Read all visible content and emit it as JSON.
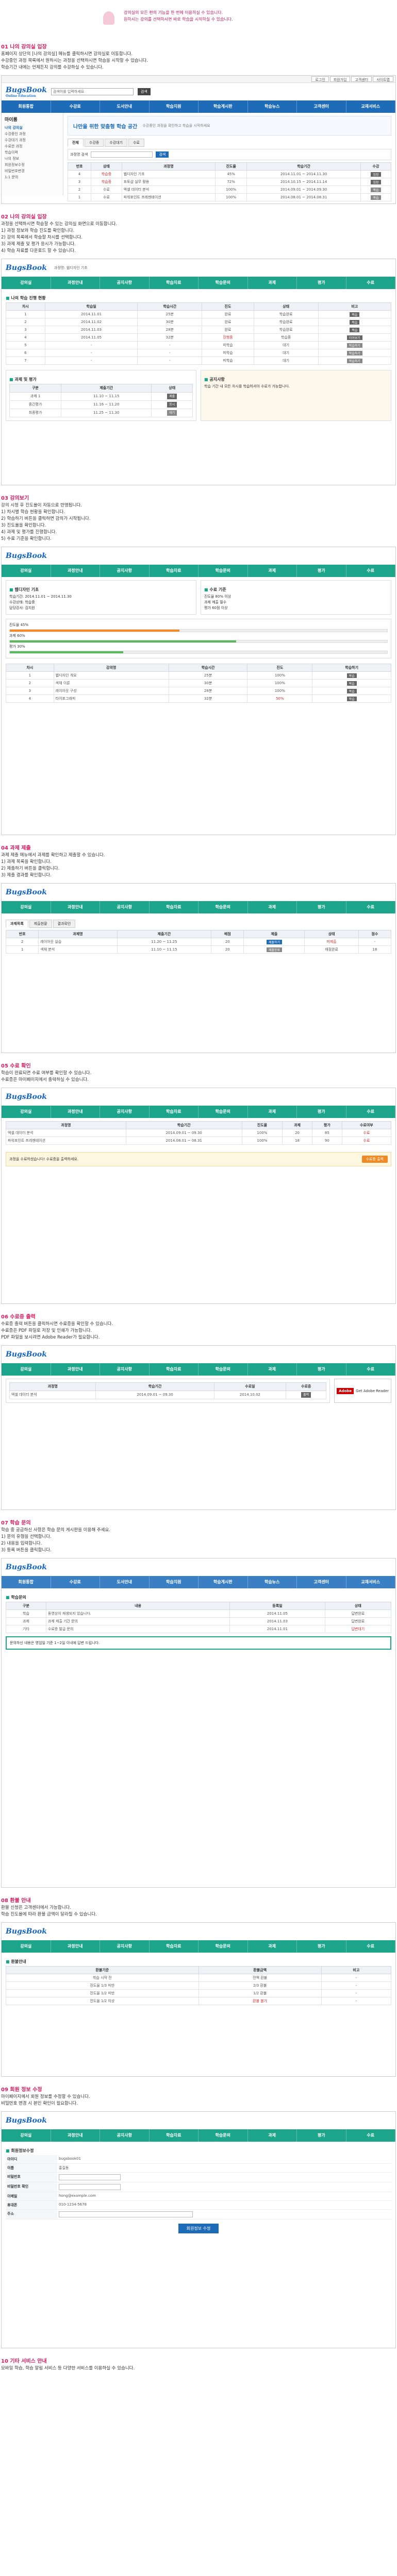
{
  "intro": {
    "lines": [
      "강의실의 모든 편의 기능을 한 번에 이용하실 수 있습니다.",
      "원하시는 강의를 선택하시면 바로 학습을 시작하실 수 있습니다."
    ]
  },
  "sections": [
    {
      "title": "01 나의 강의실 입장",
      "desc": [
        "홈페이지 상단의 [나의 강의실] 메뉴를 클릭하시면 강의실로 이동합니다.",
        "수강중인 과정 목록에서 원하시는 과정을 선택하시면 학습을 시작할 수 있습니다.",
        "학습기간 내에는 언제든지 강의를 수강하실 수 있습니다."
      ]
    },
    {
      "title": "02 나의 강의실 입장",
      "desc": [
        "과정을 선택하시면 학습할 수 있는 강의실 화면으로 이동합니다.",
        "1) 과정 정보와 학습 진도를 확인합니다.",
        "2) 강의 목록에서 학습할 차시를 선택합니다.",
        "3) 과제 제출 및 평가 응시가 가능합니다.",
        "4) 학습 자료를 다운로드 할 수 있습니다."
      ]
    },
    {
      "title": "03 강의보기",
      "desc": [
        "강의 시청 후 진도율이 자동으로 반영됩니다.",
        "1) 차시별 학습 현황을 확인합니다.",
        "2) 학습하기 버튼을 클릭하면 강의가 시작됩니다.",
        "3) 진도율을 확인합니다.",
        "4) 과제 및 평가를 진행합니다.",
        "5) 수료 기준을 확인합니다."
      ]
    },
    {
      "title": "04 과제 제출",
      "desc": [
        "과제 제출 메뉴에서 과제를 확인하고 제출할 수 있습니다.",
        "1) 과제 목록을 확인합니다.",
        "2) 제출하기 버튼을 클릭합니다.",
        "3) 제출 결과를 확인합니다."
      ]
    },
    {
      "title": "05 수료 확인",
      "desc": [
        "학습이 완료되면 수료 여부를 확인할 수 있습니다.",
        "수료증은 마이페이지에서 출력하실 수 있습니다."
      ]
    },
    {
      "title": "06 수료증 출력",
      "desc": [
        "수료증 출력 버튼을 클릭하시면 수료증을 확인할 수 있습니다.",
        "수료증은 PDF 파일로 저장 및 인쇄가 가능합니다.",
        "PDF 파일을 보시려면 Adobe Reader가 필요합니다."
      ]
    },
    {
      "title": "07 학습 문의",
      "desc": [
        "학습 중 궁금하신 사항은 학습 문의 게시판을 이용해 주세요.",
        "1) 문의 유형을 선택합니다.",
        "2) 내용을 입력합니다.",
        "3) 등록 버튼을 클릭합니다."
      ]
    },
    {
      "title": "08 환불 안내",
      "desc": [
        "환불 신청은 고객센터에서 가능합니다.",
        "학습 진도율에 따라 환불 금액이 달라질 수 있습니다."
      ]
    },
    {
      "title": "09 회원 정보 수정",
      "desc": [
        "마이페이지에서 회원 정보를 수정할 수 있습니다.",
        "비밀번호 변경 시 본인 확인이 필요합니다."
      ]
    },
    {
      "title": "10 기타 서비스 안내",
      "desc": [
        "모바일 학습, 학습 알림 서비스 등 다양한 서비스를 이용하실 수 있습니다."
      ]
    }
  ],
  "site": {
    "logo": "BugsBook",
    "logo_sub": "Online Education",
    "search_placeholder": "검색어를 입력하세요",
    "search_btn": "검색",
    "top_links": [
      "로그인",
      "회원가입",
      "고객센터",
      "사이트맵"
    ],
    "nav_blue": [
      "회원통합",
      "수강료",
      "도서안내",
      "학습지원",
      "학습게시판",
      "학습뉴스",
      "고객센터",
      "교재서비스"
    ],
    "nav_teal": [
      "강의실",
      "과정안내",
      "공지사항",
      "학습자료",
      "학습문의",
      "과제",
      "평가",
      "수료"
    ]
  },
  "classroom": {
    "title": "마이룸",
    "side_menu": [
      "나의 강의실",
      "수강중인 과정",
      "수강대기 과정",
      "수료한 과정",
      "학습이력",
      "나의 정보",
      "회원정보수정",
      "비밀번호변경",
      "1:1 문의"
    ],
    "banner_title": "나만을 위한 맞춤형 학습 공간",
    "banner_sub": "수강중인 과정을 확인하고 학습을 시작하세요",
    "tabs": [
      "전체",
      "수강중",
      "수강대기",
      "수료"
    ],
    "filter_label": "과정명 검색",
    "filter_btn": "검색",
    "columns": [
      "번호",
      "상태",
      "과정명",
      "진도율",
      "학습기간",
      "수강"
    ],
    "rows": [
      [
        "4",
        "학습중",
        "웹디자인 기초",
        "45%",
        "2014.11.01 ~ 2014.11.30",
        "입장"
      ],
      [
        "3",
        "학습중",
        "포토샵 실무 활용",
        "72%",
        "2014.10.15 ~ 2014.11.14",
        "입장"
      ],
      [
        "2",
        "수료",
        "엑셀 데이터 분석",
        "100%",
        "2014.09.01 ~ 2014.09.30",
        "복습"
      ],
      [
        "1",
        "수료",
        "파워포인트 프레젠테이션",
        "100%",
        "2014.08.01 ~ 2014.08.31",
        "복습"
      ]
    ]
  },
  "lecture": {
    "breadcrumb": "과정명: 웹디자인 기초",
    "title": "나의 학습 진행 현황",
    "columns": [
      "차시",
      "학습일",
      "학습시간",
      "진도",
      "상태",
      "비고"
    ],
    "rows": [
      [
        "1",
        "2014.11.01",
        "25분",
        "완료",
        "학습완료",
        "복습"
      ],
      [
        "2",
        "2014.11.02",
        "30분",
        "완료",
        "학습완료",
        "복습"
      ],
      [
        "3",
        "2014.11.03",
        "28분",
        "완료",
        "학습완료",
        "복습"
      ],
      [
        "4",
        "2014.11.05",
        "32분",
        "진행중",
        "학습중",
        "이어보기"
      ],
      [
        "5",
        "-",
        "-",
        "미학습",
        "대기",
        "학습하기"
      ],
      [
        "6",
        "-",
        "-",
        "미학습",
        "대기",
        "학습하기"
      ],
      [
        "7",
        "-",
        "-",
        "미학습",
        "대기",
        "학습하기"
      ]
    ],
    "task_title": "과제 및 평가",
    "task_cols": [
      "구분",
      "제출기간",
      "상태"
    ],
    "task_rows": [
      [
        "과제 1",
        "11.10 ~ 11.15",
        "제출"
      ],
      [
        "중간평가",
        "11.16 ~ 11.20",
        "응시"
      ],
      [
        "최종평가",
        "11.25 ~ 11.30",
        "대기"
      ]
    ],
    "notice_title": "공지사항",
    "notice_text": "학습 기간 내 모든 차시를 학습하셔야 수료가 가능합니다."
  },
  "progress": {
    "course": "웹디자인 기초",
    "info": [
      "학습기간: 2014.11.01 ~ 2014.11.30",
      "수강상태: 학습중",
      "담당강사: 김지원"
    ],
    "items": [
      {
        "label": "진도율",
        "value": 0.45,
        "text": "45%"
      },
      {
        "label": "과제",
        "value": 0.6,
        "text": "60%"
      },
      {
        "label": "평가",
        "value": 0.3,
        "text": "30%"
      }
    ],
    "criteria_title": "수료 기준",
    "criteria": [
      "진도율 80% 이상",
      "과제 제출 필수",
      "평가 60점 이상"
    ],
    "list_cols": [
      "차시",
      "강의명",
      "학습시간",
      "진도",
      "학습하기"
    ],
    "list_rows": [
      [
        "1",
        "웹디자인 개요",
        "25분",
        "100%",
        "복습"
      ],
      [
        "2",
        "색채 이론",
        "30분",
        "100%",
        "복습"
      ],
      [
        "3",
        "레이아웃 구성",
        "28분",
        "100%",
        "복습"
      ],
      [
        "4",
        "타이포그래피",
        "32분",
        "50%",
        "학습"
      ]
    ]
  },
  "assignment": {
    "tabs": [
      "과제목록",
      "제출현황",
      "결과확인"
    ],
    "columns": [
      "번호",
      "과제명",
      "제출기간",
      "배점",
      "제출",
      "상태",
      "점수"
    ],
    "rows": [
      [
        "2",
        "레이아웃 실습",
        "11.20 ~ 11.25",
        "20",
        "제출하기",
        "미제출",
        "-"
      ],
      [
        "1",
        "색채 분석",
        "11.10 ~ 11.15",
        "20",
        "제출완료",
        "채점완료",
        "18"
      ]
    ]
  },
  "completion": {
    "cols": [
      "과정명",
      "학습기간",
      "진도율",
      "과제",
      "평가",
      "수료여부"
    ],
    "rows": [
      [
        "엑셀 데이터 분석",
        "2014.09.01 ~ 09.30",
        "100%",
        "20",
        "85",
        "수료"
      ],
      [
        "파워포인트 프레젠테이션",
        "2014.08.01 ~ 08.31",
        "100%",
        "18",
        "90",
        "수료"
      ]
    ],
    "promo_text": "과정을 수료하셨습니다! 수료증을 출력하세요.",
    "promo_btn": "수료증 출력"
  },
  "certificate": {
    "cols": [
      "과정명",
      "학습기간",
      "수료일",
      "수료증"
    ],
    "row": [
      "엑셀 데이터 분석",
      "2014.09.01 ~ 09.30",
      "2014.10.02",
      "출력"
    ],
    "adobe_label": "Get Adobe Reader",
    "adobe_tag": "Adobe"
  },
  "inquiry": {
    "title": "학습문의",
    "cols": [
      "구분",
      "내용",
      "등록일",
      "상태"
    ],
    "rows": [
      [
        "학습",
        "동영상이 재생되지 않습니다.",
        "2014.11.05",
        "답변완료"
      ],
      [
        "과제",
        "과제 제출 기간 문의",
        "2014.11.03",
        "답변완료"
      ],
      [
        "기타",
        "수료증 발급 문의",
        "2014.11.01",
        "답변대기"
      ]
    ],
    "green_note": "문의하신 내용은 영업일 기준 1~2일 이내에 답변 드립니다."
  },
  "refund": {
    "title": "환불안내",
    "cols": [
      "환불기준",
      "환불금액",
      "비고"
    ],
    "rows": [
      [
        "학습 시작 전",
        "전액 환불",
        "-"
      ],
      [
        "진도율 1/3 미만",
        "2/3 환불",
        "-"
      ],
      [
        "진도율 1/2 미만",
        "1/2 환불",
        "-"
      ],
      [
        "진도율 1/2 이상",
        "환불 불가",
        "-"
      ]
    ]
  },
  "member": {
    "title": "회원정보수정",
    "fields": [
      {
        "k": "아이디",
        "v": "bugsbook01"
      },
      {
        "k": "이름",
        "v": "홍길동"
      },
      {
        "k": "비밀번호",
        "v": ""
      },
      {
        "k": "비밀번호 확인",
        "v": ""
      },
      {
        "k": "이메일",
        "v": "hong@example.com"
      },
      {
        "k": "휴대폰",
        "v": "010-1234-5678"
      },
      {
        "k": "주소",
        "v": ""
      }
    ],
    "submit": "회원정보 수정"
  }
}
